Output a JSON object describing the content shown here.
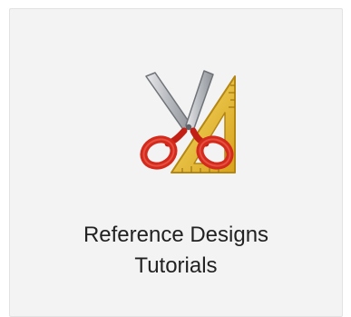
{
  "tile": {
    "icon": "scissors-and-set-square-icon",
    "label_line1": "Reference Designs",
    "label_line2": "Tutorials"
  },
  "colors": {
    "card_background": "#f3f3f3",
    "scissors_handles": "#d42a1c",
    "scissors_blades": "#b9bcc1",
    "set_square": "#e9c13a",
    "text": "#222222"
  }
}
